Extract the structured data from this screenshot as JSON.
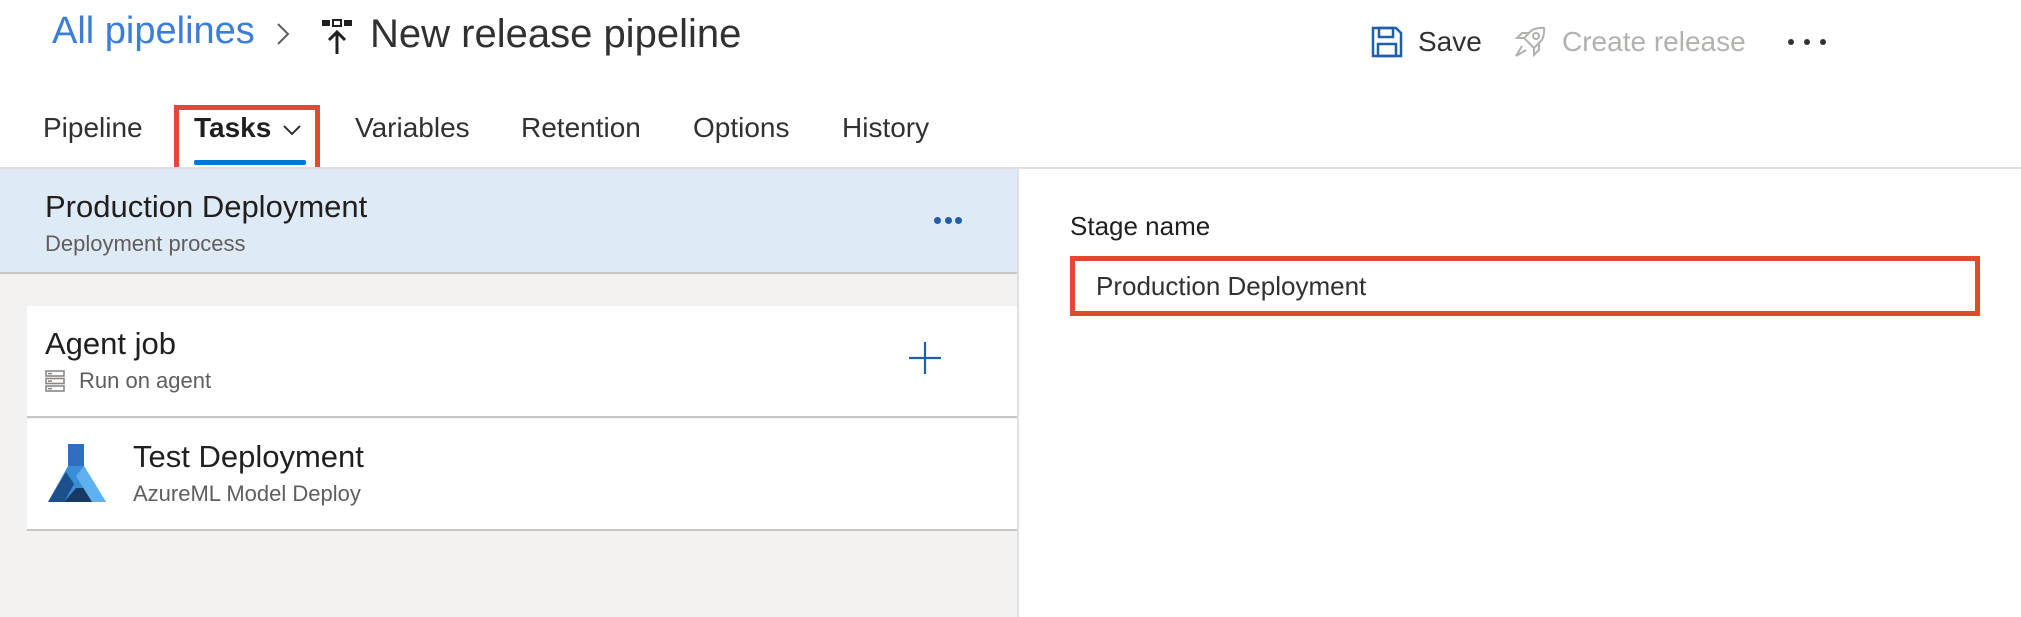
{
  "header": {
    "breadcrumb": "All pipelines",
    "title": "New release pipeline",
    "save_label": "Save",
    "create_release_label": "Create release"
  },
  "tabs": [
    {
      "label": "Pipeline"
    },
    {
      "label": "Tasks",
      "active": true
    },
    {
      "label": "Variables"
    },
    {
      "label": "Retention"
    },
    {
      "label": "Options"
    },
    {
      "label": "History"
    }
  ],
  "stage": {
    "title": "Production Deployment",
    "subtitle": "Deployment process"
  },
  "agent_job": {
    "title": "Agent job",
    "subtitle": "Run on agent"
  },
  "task": {
    "title": "Test Deployment",
    "subtitle": "AzureML Model Deploy"
  },
  "stage_form": {
    "label": "Stage name",
    "value": "Production Deployment"
  },
  "colors": {
    "accent": "#0078d4",
    "link": "#3b7dd8",
    "highlight": "#e04a2e",
    "stage_bg": "#deeaf6"
  }
}
